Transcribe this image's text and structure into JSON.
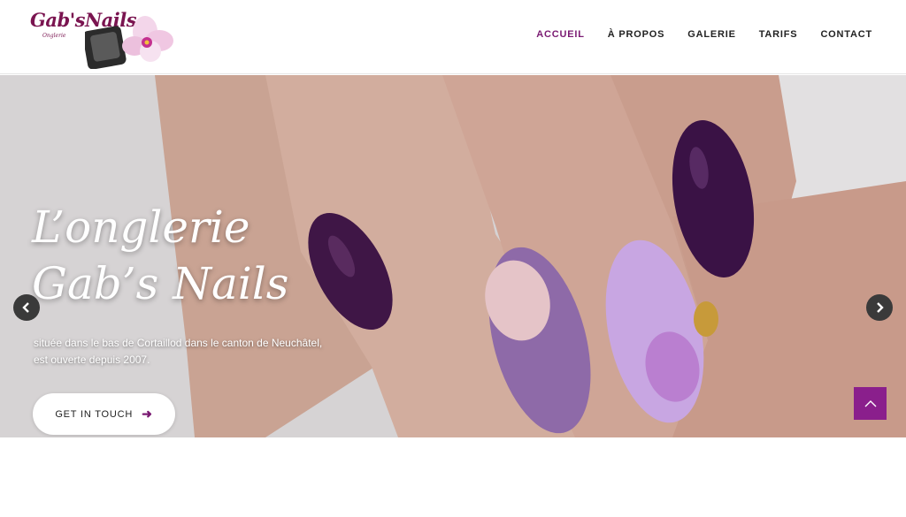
{
  "brand": {
    "logo_text": "Gab'sNails",
    "logo_subtext": "Onglerie"
  },
  "nav": {
    "items": [
      {
        "label": "ACCUEIL",
        "active": true
      },
      {
        "label": "À PROPOS",
        "active": false
      },
      {
        "label": "GALERIE",
        "active": false
      },
      {
        "label": "TARIFS",
        "active": false
      },
      {
        "label": "CONTACT",
        "active": false
      }
    ]
  },
  "hero": {
    "title_line1": "L’onglerie",
    "title_line2": "Gab’s Nails",
    "subtitle_line1": "située dans le bas de Cortaillod dans le canton de Neuchâtel,",
    "subtitle_line2": "est ouverte depuis 2007.",
    "cta_label": "GET IN TOUCH"
  },
  "icons": {
    "prev": "chevron-left-icon",
    "next": "chevron-right-icon",
    "cta": "arrow-right-icon",
    "scroll_top": "chevron-up-icon"
  },
  "colors": {
    "accent": "#7a1a72",
    "scroll_top_bg": "#8a1f8c",
    "logo": "#7a1450"
  }
}
